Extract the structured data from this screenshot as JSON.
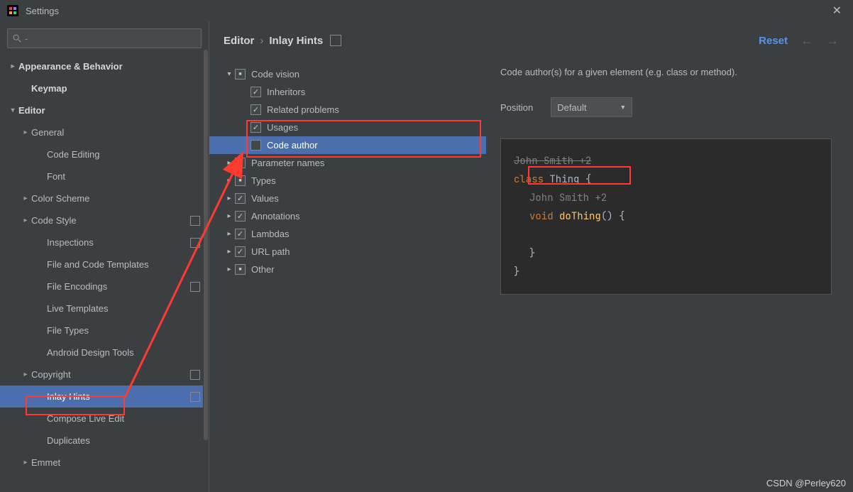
{
  "titlebar": {
    "title": "Settings"
  },
  "search": {
    "placeholder": ""
  },
  "sidebar": [
    {
      "label": "Appearance & Behavior",
      "indent": 0,
      "arrow": "right",
      "bold": true
    },
    {
      "label": "Keymap",
      "indent": 1,
      "arrow": "",
      "bold": true
    },
    {
      "label": "Editor",
      "indent": 0,
      "arrow": "down",
      "bold": true
    },
    {
      "label": "General",
      "indent": 1,
      "arrow": "right"
    },
    {
      "label": "Code Editing",
      "indent": 2,
      "arrow": ""
    },
    {
      "label": "Font",
      "indent": 2,
      "arrow": ""
    },
    {
      "label": "Color Scheme",
      "indent": 1,
      "arrow": "right"
    },
    {
      "label": "Code Style",
      "indent": 1,
      "arrow": "right",
      "badge": true
    },
    {
      "label": "Inspections",
      "indent": 2,
      "arrow": "",
      "badge": true
    },
    {
      "label": "File and Code Templates",
      "indent": 2,
      "arrow": ""
    },
    {
      "label": "File Encodings",
      "indent": 2,
      "arrow": "",
      "badge": true
    },
    {
      "label": "Live Templates",
      "indent": 2,
      "arrow": ""
    },
    {
      "label": "File Types",
      "indent": 2,
      "arrow": ""
    },
    {
      "label": "Android Design Tools",
      "indent": 2,
      "arrow": ""
    },
    {
      "label": "Copyright",
      "indent": 1,
      "arrow": "right",
      "badge": true
    },
    {
      "label": "Inlay Hints",
      "indent": 2,
      "arrow": "",
      "badge": true,
      "selected": true
    },
    {
      "label": "Compose Live Edit",
      "indent": 2,
      "arrow": ""
    },
    {
      "label": "Duplicates",
      "indent": 2,
      "arrow": ""
    },
    {
      "label": "Emmet",
      "indent": 1,
      "arrow": "right"
    }
  ],
  "breadcrumb": {
    "root": "Editor",
    "current": "Inlay Hints",
    "reset": "Reset"
  },
  "middle_tree": [
    {
      "indent": 0,
      "arrow": "down",
      "check": "mixed",
      "label": "Code vision"
    },
    {
      "indent": 1,
      "arrow": "",
      "check": "checked",
      "label": "Inheritors"
    },
    {
      "indent": 1,
      "arrow": "",
      "check": "checked",
      "label": "Related problems"
    },
    {
      "indent": 1,
      "arrow": "",
      "check": "checked",
      "label": "Usages"
    },
    {
      "indent": 1,
      "arrow": "",
      "check": "none",
      "label": "Code author",
      "selected": true
    },
    {
      "indent": 0,
      "arrow": "right",
      "check": "mixed",
      "label": "Parameter names"
    },
    {
      "indent": 0,
      "arrow": "right",
      "check": "mixed",
      "label": "Types"
    },
    {
      "indent": 0,
      "arrow": "right",
      "check": "checked",
      "label": "Values"
    },
    {
      "indent": 0,
      "arrow": "right",
      "check": "checked",
      "label": "Annotations"
    },
    {
      "indent": 0,
      "arrow": "right",
      "check": "checked",
      "label": "Lambdas"
    },
    {
      "indent": 0,
      "arrow": "right",
      "check": "checked",
      "label": "URL path"
    },
    {
      "indent": 0,
      "arrow": "right",
      "check": "mixed",
      "label": "Other"
    }
  ],
  "details": {
    "description": "Code author(s) for a given element (e.g. class or method).",
    "position_label": "Position",
    "position_value": "Default"
  },
  "code": {
    "hint1": "John Smith +2",
    "kw_class": "class",
    "classname": "Thing",
    "open_brace": "{",
    "hint2": "John Smith +2",
    "kw_void": "void",
    "method": "doThing",
    "parens": "()",
    "open_brace2": "{",
    "close_brace2": "}",
    "close_brace": "}"
  },
  "watermark": "CSDN @Perley620"
}
